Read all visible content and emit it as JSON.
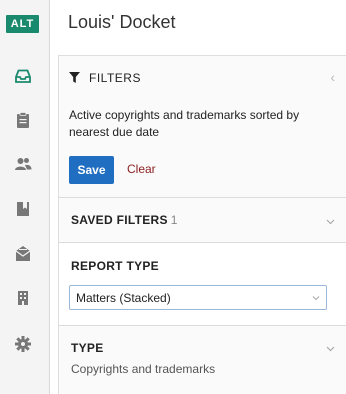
{
  "app": {
    "logo": "ALT",
    "title": "Louis' Docket"
  },
  "rail": {
    "items": [
      {
        "icon": "inbox-icon"
      },
      {
        "icon": "clipboard-icon"
      },
      {
        "icon": "users-icon"
      },
      {
        "icon": "bookmark-icon"
      },
      {
        "icon": "mail-icon"
      },
      {
        "icon": "building-icon"
      },
      {
        "icon": "gear-icon"
      }
    ]
  },
  "filters": {
    "label": "FILTERS",
    "description": "Active copyrights and trademarks sorted by nearest due date",
    "save_label": "Save",
    "clear_label": "Clear"
  },
  "saved_filters": {
    "label": "SAVED FILTERS",
    "count": "1"
  },
  "report_type": {
    "label": "REPORT TYPE",
    "selected": "Matters (Stacked)"
  },
  "type": {
    "label": "TYPE",
    "value": "Copyrights and trademarks"
  },
  "colors": {
    "accent": "#1f6ec1",
    "logo": "#1a8a6e",
    "clear": "#8a1f1f"
  }
}
